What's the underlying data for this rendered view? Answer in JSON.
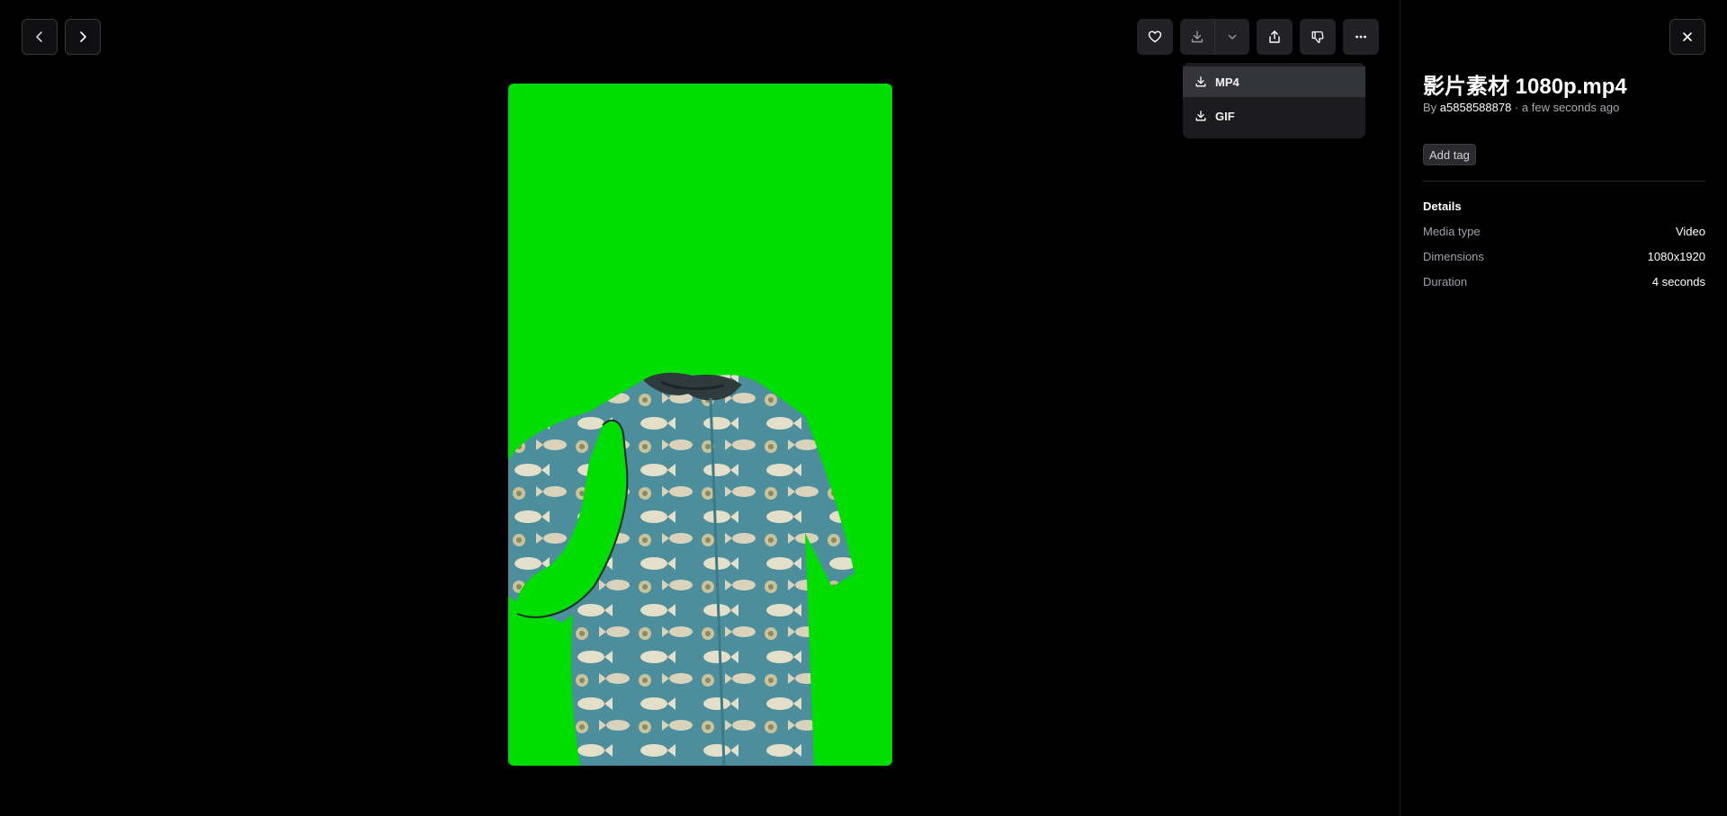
{
  "nav": {
    "prev_icon": "chevron-left-icon",
    "next_icon": "chevron-right-icon"
  },
  "toolbar": {
    "like_icon": "heart-icon",
    "download_icon": "download-icon",
    "download_menu_icon": "chevron-down-icon",
    "share_icon": "share-icon",
    "dislike_icon": "thumbs-down-icon",
    "more_icon": "more-horizontal-icon"
  },
  "download_menu": {
    "items": [
      {
        "label": "MP4",
        "icon": "download-icon",
        "active": true
      },
      {
        "label": "GIF",
        "icon": "download-icon",
        "active": false
      }
    ]
  },
  "panel": {
    "close_icon": "close-icon",
    "title": "影片素材 1080p.mp4",
    "by_prefix": "By",
    "author": "a5858588878",
    "time_suffix": "· a few seconds ago",
    "add_tag": "Add tag",
    "details_heading": "Details",
    "details": [
      {
        "key": "Media type",
        "value": "Video"
      },
      {
        "key": "Dimensions",
        "value": "1080x1920"
      },
      {
        "key": "Duration",
        "value": "4 seconds"
      }
    ]
  },
  "colors": {
    "background": "#000000",
    "green_screen": "#00dd00",
    "shirt": "#4a8d9a",
    "button_bg": "#222226",
    "menu_bg": "#1c1c1f"
  }
}
